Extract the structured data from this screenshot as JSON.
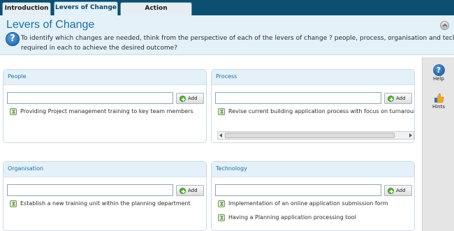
{
  "tabs": [
    {
      "label": "Introduction",
      "active": false
    },
    {
      "label": "Levers of Change",
      "active": true
    },
    {
      "label": "Action Prioritisation",
      "active": false
    }
  ],
  "header": {
    "title": "Levers of Change",
    "description_line1": "To identify which changes are needed, think from the perspective of each of the levers of change ? people, process, organisation and technology. Wha",
    "description_line2": "required in each to achieve the desired outcome?"
  },
  "sidebar": {
    "help_label": "Help",
    "hints_label": "Hints"
  },
  "panels": {
    "people": {
      "title": "People",
      "input_value": "",
      "add_label": "Add",
      "items": [
        "Providing Project management training to key team members"
      ]
    },
    "process": {
      "title": "Process",
      "input_value": "",
      "add_label": "Add",
      "items": [
        "Revise current building application process with focus on turnaround t"
      ]
    },
    "organisation": {
      "title": "Organisation",
      "input_value": "",
      "add_label": "Add",
      "items": [
        "Establish a new training unit within the planning department"
      ]
    },
    "technology": {
      "title": "Technology",
      "input_value": "",
      "add_label": "Add",
      "items": [
        "Implementation of an online application submission form",
        "Having a Planning application processing tool"
      ]
    }
  },
  "colors": {
    "tabbar": "#0c4f70",
    "header_bg": "#e4f1f9",
    "title_blue": "#1c6fa5",
    "sidebar_bg": "#e5e5e5"
  },
  "icons": [
    "help-circle-icon",
    "collapse-icon",
    "add-icon",
    "item-icon",
    "hints-thumbs-up-icon"
  ]
}
